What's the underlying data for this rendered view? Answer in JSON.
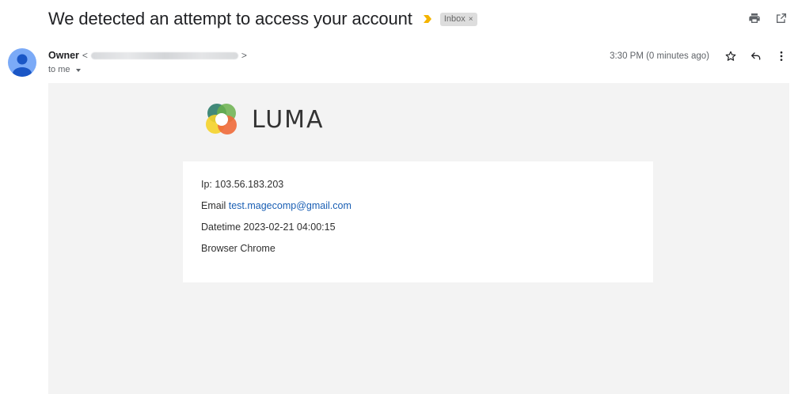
{
  "subject": "We detected an attempt to access your account",
  "label": "Inbox",
  "label_close": "×",
  "sender": {
    "name": "Owner",
    "bracket_open": "<",
    "bracket_close": ">",
    "to": "to me"
  },
  "timestamp": "3:30 PM (0 minutes ago)",
  "icons": {
    "print": "print-icon",
    "open_new_window": "open-in-new-window-icon",
    "star": "star-icon",
    "reply": "reply-icon",
    "more": "more-vert-icon"
  },
  "brand": {
    "name": "LUMA"
  },
  "details": {
    "ip_line": "Ip: 103.56.183.203",
    "email_label": "Email",
    "email_value": "test.magecomp@gmail.com",
    "datetime_line": "Datetime 2023-02-21 04:00:15",
    "browser_line": "Browser Chrome"
  },
  "colors": {
    "importance_marker": "#f4b400",
    "avatar": "#7baaf7",
    "link": "#1a5fb4",
    "body_bg": "#f3f3f3"
  }
}
